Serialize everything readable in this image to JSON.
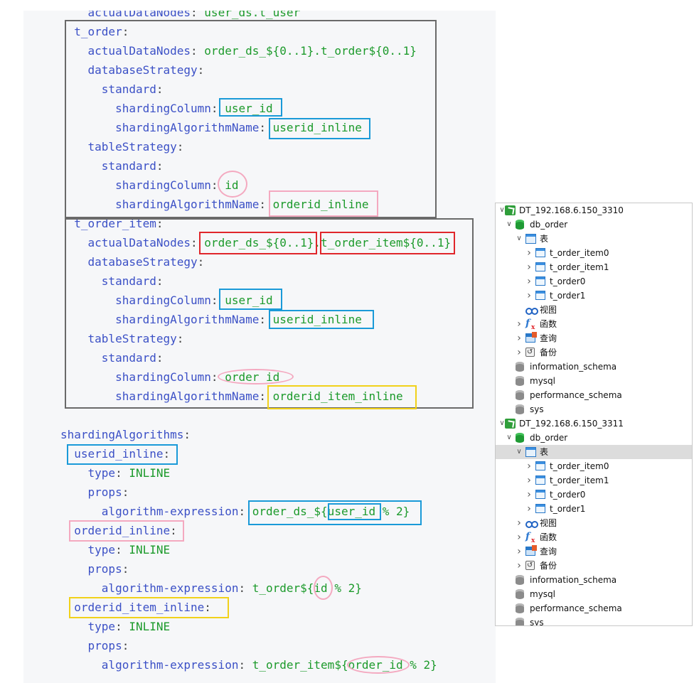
{
  "code_lines": [
    [
      {
        "t": "    actualDataNodes",
        "c": "k"
      },
      {
        "t": ": ",
        "c": "p"
      },
      {
        "t": "user_ds.t_user",
        "c": "v"
      }
    ],
    [
      {
        "t": "  t_order",
        "c": "k"
      },
      {
        "t": ":",
        "c": "p"
      }
    ],
    [
      {
        "t": "    actualDataNodes",
        "c": "k"
      },
      {
        "t": ": ",
        "c": "p"
      },
      {
        "t": "order_ds_${0..1}.t_order${0..1}",
        "c": "v"
      }
    ],
    [
      {
        "t": "    databaseStrategy",
        "c": "k"
      },
      {
        "t": ":",
        "c": "p"
      }
    ],
    [
      {
        "t": "      standard",
        "c": "k"
      },
      {
        "t": ":",
        "c": "p"
      }
    ],
    [
      {
        "t": "        shardingColumn",
        "c": "k"
      },
      {
        "t": ": ",
        "c": "p"
      },
      {
        "t": "user_id",
        "c": "v"
      }
    ],
    [
      {
        "t": "        shardingAlgorithmName",
        "c": "k"
      },
      {
        "t": ": ",
        "c": "p"
      },
      {
        "t": "userid_inline",
        "c": "v"
      }
    ],
    [
      {
        "t": "    tableStrategy",
        "c": "k"
      },
      {
        "t": ":",
        "c": "p"
      }
    ],
    [
      {
        "t": "      standard",
        "c": "k"
      },
      {
        "t": ":",
        "c": "p"
      }
    ],
    [
      {
        "t": "        shardingColumn",
        "c": "k"
      },
      {
        "t": ": ",
        "c": "p"
      },
      {
        "t": "id",
        "c": "v"
      }
    ],
    [
      {
        "t": "        shardingAlgorithmName",
        "c": "k"
      },
      {
        "t": ": ",
        "c": "p"
      },
      {
        "t": "orderid_inline",
        "c": "v"
      }
    ],
    [
      {
        "t": "  t_order_item",
        "c": "k"
      },
      {
        "t": ":",
        "c": "p"
      }
    ],
    [
      {
        "t": "    actualDataNodes",
        "c": "k"
      },
      {
        "t": ": ",
        "c": "p"
      },
      {
        "t": "order_ds_${0..1}.t_order_item${0..1}",
        "c": "v"
      }
    ],
    [
      {
        "t": "    databaseStrategy",
        "c": "k"
      },
      {
        "t": ":",
        "c": "p"
      }
    ],
    [
      {
        "t": "      standard",
        "c": "k"
      },
      {
        "t": ":",
        "c": "p"
      }
    ],
    [
      {
        "t": "        shardingColumn",
        "c": "k"
      },
      {
        "t": ": ",
        "c": "p"
      },
      {
        "t": "user_id",
        "c": "v"
      }
    ],
    [
      {
        "t": "        shardingAlgorithmName",
        "c": "k"
      },
      {
        "t": ": ",
        "c": "p"
      },
      {
        "t": "userid_inline",
        "c": "v"
      }
    ],
    [
      {
        "t": "    tableStrategy",
        "c": "k"
      },
      {
        "t": ":",
        "c": "p"
      }
    ],
    [
      {
        "t": "      standard",
        "c": "k"
      },
      {
        "t": ":",
        "c": "p"
      }
    ],
    [
      {
        "t": "        shardingColumn",
        "c": "k"
      },
      {
        "t": ": ",
        "c": "p"
      },
      {
        "t": "order_id",
        "c": "v"
      }
    ],
    [
      {
        "t": "        shardingAlgorithmName",
        "c": "k"
      },
      {
        "t": ": ",
        "c": "p"
      },
      {
        "t": "orderid_item_inline",
        "c": "v"
      }
    ],
    [],
    [
      {
        "t": "shardingAlgorithms",
        "c": "k"
      },
      {
        "t": ":",
        "c": "p"
      }
    ],
    [
      {
        "t": "  userid_inline",
        "c": "k"
      },
      {
        "t": ":",
        "c": "p"
      }
    ],
    [
      {
        "t": "    type",
        "c": "k"
      },
      {
        "t": ": ",
        "c": "p"
      },
      {
        "t": "INLINE",
        "c": "v"
      }
    ],
    [
      {
        "t": "    props",
        "c": "k"
      },
      {
        "t": ":",
        "c": "p"
      }
    ],
    [
      {
        "t": "      algorithm-expression",
        "c": "k"
      },
      {
        "t": ": ",
        "c": "p"
      },
      {
        "t": "order_ds_${user_id % 2}",
        "c": "v"
      }
    ],
    [
      {
        "t": "  orderid_inline",
        "c": "k"
      },
      {
        "t": ":",
        "c": "p"
      }
    ],
    [
      {
        "t": "    type",
        "c": "k"
      },
      {
        "t": ": ",
        "c": "p"
      },
      {
        "t": "INLINE",
        "c": "v"
      }
    ],
    [
      {
        "t": "    props",
        "c": "k"
      },
      {
        "t": ":",
        "c": "p"
      }
    ],
    [
      {
        "t": "      algorithm-expression",
        "c": "k"
      },
      {
        "t": ": ",
        "c": "p"
      },
      {
        "t": "t_order${id % 2}",
        "c": "v"
      }
    ],
    [
      {
        "t": "  orderid_item_inline",
        "c": "k"
      },
      {
        "t": ":",
        "c": "p"
      }
    ],
    [
      {
        "t": "    type",
        "c": "k"
      },
      {
        "t": ": ",
        "c": "p"
      },
      {
        "t": "INLINE",
        "c": "v"
      }
    ],
    [
      {
        "t": "    props",
        "c": "k"
      },
      {
        "t": ":",
        "c": "p"
      }
    ],
    [
      {
        "t": "      algorithm-expression",
        "c": "k"
      },
      {
        "t": ": ",
        "c": "p"
      },
      {
        "t": "t_order_item${order_id % 2}",
        "c": "v"
      }
    ]
  ],
  "tree": [
    {
      "label": "DT_192.168.6.150_3310",
      "icon": "connection-icon",
      "level": 0,
      "expanded": true
    },
    {
      "label": "db_order",
      "icon": "database-icon",
      "level": 1,
      "expanded": true
    },
    {
      "label": "表",
      "icon": "tables-icon",
      "level": 2,
      "expanded": true
    },
    {
      "label": "t_order_item0",
      "icon": "table-icon",
      "level": 3,
      "expanded": false
    },
    {
      "label": "t_order_item1",
      "icon": "table-icon",
      "level": 3,
      "expanded": false
    },
    {
      "label": "t_order0",
      "icon": "table-icon",
      "level": 3,
      "expanded": false
    },
    {
      "label": "t_order1",
      "icon": "table-icon",
      "level": 3,
      "expanded": false
    },
    {
      "label": "视图",
      "icon": "view-icon",
      "level": 2,
      "expanded": null
    },
    {
      "label": "函数",
      "icon": "function-icon",
      "level": 2,
      "expanded": false
    },
    {
      "label": "查询",
      "icon": "query-icon",
      "level": 2,
      "expanded": false
    },
    {
      "label": "备份",
      "icon": "backup-icon",
      "level": 2,
      "expanded": false
    },
    {
      "label": "information_schema",
      "icon": "database-gray-icon",
      "level": 1,
      "expanded": null
    },
    {
      "label": "mysql",
      "icon": "database-gray-icon",
      "level": 1,
      "expanded": null
    },
    {
      "label": "performance_schema",
      "icon": "database-gray-icon",
      "level": 1,
      "expanded": null
    },
    {
      "label": "sys",
      "icon": "database-gray-icon",
      "level": 1,
      "expanded": null
    },
    {
      "label": "DT_192.168.6.150_3311",
      "icon": "connection-icon",
      "level": 0,
      "expanded": true
    },
    {
      "label": "db_order",
      "icon": "database-icon",
      "level": 1,
      "expanded": true
    },
    {
      "label": "表",
      "icon": "tables-icon",
      "level": 2,
      "expanded": true,
      "selected": true
    },
    {
      "label": "t_order_item0",
      "icon": "table-icon",
      "level": 3,
      "expanded": false
    },
    {
      "label": "t_order_item1",
      "icon": "table-icon",
      "level": 3,
      "expanded": false
    },
    {
      "label": "t_order0",
      "icon": "table-icon",
      "level": 3,
      "expanded": false
    },
    {
      "label": "t_order1",
      "icon": "table-icon",
      "level": 3,
      "expanded": false
    },
    {
      "label": "视图",
      "icon": "view-icon",
      "level": 2,
      "expanded": false
    },
    {
      "label": "函数",
      "icon": "function-icon",
      "level": 2,
      "expanded": false
    },
    {
      "label": "查询",
      "icon": "query-icon",
      "level": 2,
      "expanded": false
    },
    {
      "label": "备份",
      "icon": "backup-icon",
      "level": 2,
      "expanded": false
    },
    {
      "label": "information_schema",
      "icon": "database-gray-icon",
      "level": 1,
      "expanded": null
    },
    {
      "label": "mysql",
      "icon": "database-gray-icon",
      "level": 1,
      "expanded": null
    },
    {
      "label": "performance_schema",
      "icon": "database-gray-icon",
      "level": 1,
      "expanded": null
    },
    {
      "label": "sys",
      "icon": "database-gray-icon",
      "level": 1,
      "expanded": null
    }
  ],
  "annotation_colors": {
    "frame": "#6a6a6a",
    "algorithm_user": "#1a9ad8",
    "data_nodes": "#e0262b",
    "algorithm_item": "#f1d11a",
    "algorithm_order": "#f4a9c0"
  }
}
